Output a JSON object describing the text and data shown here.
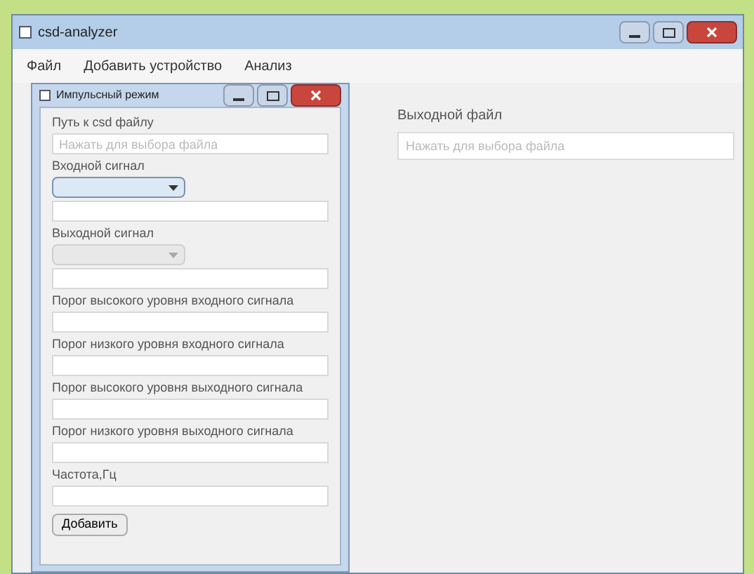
{
  "window": {
    "title": "csd-analyzer"
  },
  "menu": [
    "Файл",
    "Добавить устройство",
    "Анализ"
  ],
  "dialog": {
    "title": "Импульсный режим",
    "items": [
      {
        "kind": "label",
        "text": "Путь к csd файлу"
      },
      {
        "kind": "text",
        "placeholder": "Нажать для выбора файла"
      },
      {
        "kind": "label",
        "text": "Входной сигнал"
      },
      {
        "kind": "combo",
        "disabled": false
      },
      {
        "kind": "text"
      },
      {
        "kind": "label",
        "text": "Выходной сигнал"
      },
      {
        "kind": "combo",
        "disabled": true
      },
      {
        "kind": "text"
      },
      {
        "kind": "label",
        "text": "Порог высокого уровня входного сигнала"
      },
      {
        "kind": "text"
      },
      {
        "kind": "label",
        "text": "Порог низкого уровня входного сигнала"
      },
      {
        "kind": "text"
      },
      {
        "kind": "label",
        "text": "Порог высокого уровня выходного сигнала"
      },
      {
        "kind": "text"
      },
      {
        "kind": "label",
        "text": "Порог низкого уровня выходного сигнала"
      },
      {
        "kind": "text"
      },
      {
        "kind": "label",
        "text": "Частота,Гц"
      },
      {
        "kind": "text"
      },
      {
        "kind": "button",
        "text": "Добавить"
      }
    ]
  },
  "output": {
    "label": "Выходной файл",
    "placeholder": "Нажать для выбора файла"
  }
}
